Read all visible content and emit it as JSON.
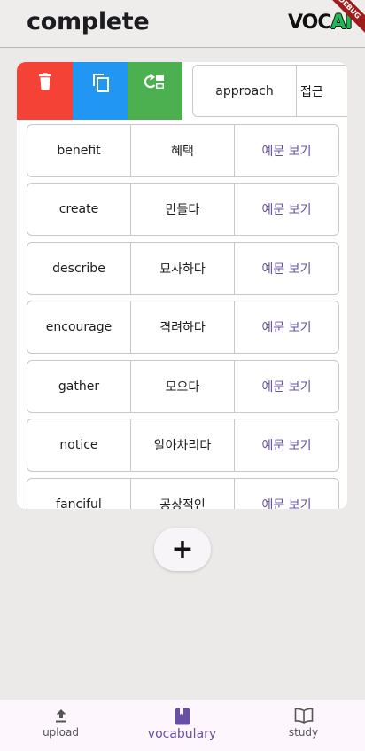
{
  "appbar": {
    "title": "complete",
    "logo_voc": "VOC",
    "logo_ai": "AI",
    "debug_banner": "DEBUG"
  },
  "colors": {
    "delete": "#f44336",
    "copy": "#2196f3",
    "swap": "#4caf50",
    "accent": "#6750a4"
  },
  "actions": {
    "delete_icon": "trash-icon",
    "copy_icon": "copy-icon",
    "swap_icon": "swap-icon"
  },
  "slid_item": {
    "word": "approach",
    "meaning": "접근"
  },
  "words": [
    {
      "word": "benefit",
      "meaning": "혜택",
      "example": "예문 보기"
    },
    {
      "word": "create",
      "meaning": "만들다",
      "example": "예문 보기"
    },
    {
      "word": "describe",
      "meaning": "묘사하다",
      "example": "예문 보기"
    },
    {
      "word": "encourage",
      "meaning": "격려하다",
      "example": "예문 보기"
    },
    {
      "word": "gather",
      "meaning": "모으다",
      "example": "예문 보기"
    },
    {
      "word": "notice",
      "meaning": "알아차리다",
      "example": "예문 보기"
    },
    {
      "word": "fanciful",
      "meaning": "공상적인",
      "example": "예문 보기"
    }
  ],
  "fab": {
    "label": "+"
  },
  "nav": [
    {
      "label": "upload",
      "icon": "upload-icon",
      "active": false
    },
    {
      "label": "vocabulary",
      "icon": "book-icon",
      "active": true
    },
    {
      "label": "study",
      "icon": "open-book-icon",
      "active": false
    }
  ]
}
